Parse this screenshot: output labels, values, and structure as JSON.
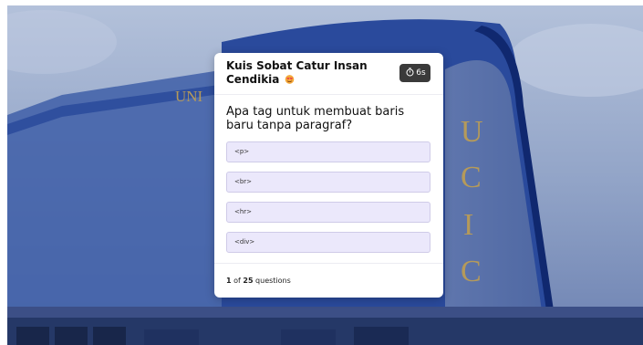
{
  "background": {
    "sign_left": "UNI",
    "sign_right_letters": [
      "U",
      "C",
      "I",
      "C"
    ]
  },
  "quiz": {
    "title": "Kuis Sobat Catur Insan Cendikia",
    "title_emoji_icon": "smiling-face-with-heart-eyes-icon",
    "timer_icon": "stopwatch-icon",
    "timer": "6s",
    "question": "Apa tag untuk membuat baris baru tanpa paragraf?",
    "options": [
      "<p>",
      "<br>",
      "<hr>",
      "<div>"
    ],
    "progress": {
      "current": "1",
      "separator": " of ",
      "total": "25",
      "suffix": " questions"
    }
  },
  "colors": {
    "option_bg": "#ebe8fb",
    "option_border": "#cfcbe8",
    "timer_bg": "#3a3a3a",
    "building_blue": "#1c3a8c",
    "sign_gold": "#b59a5a"
  }
}
